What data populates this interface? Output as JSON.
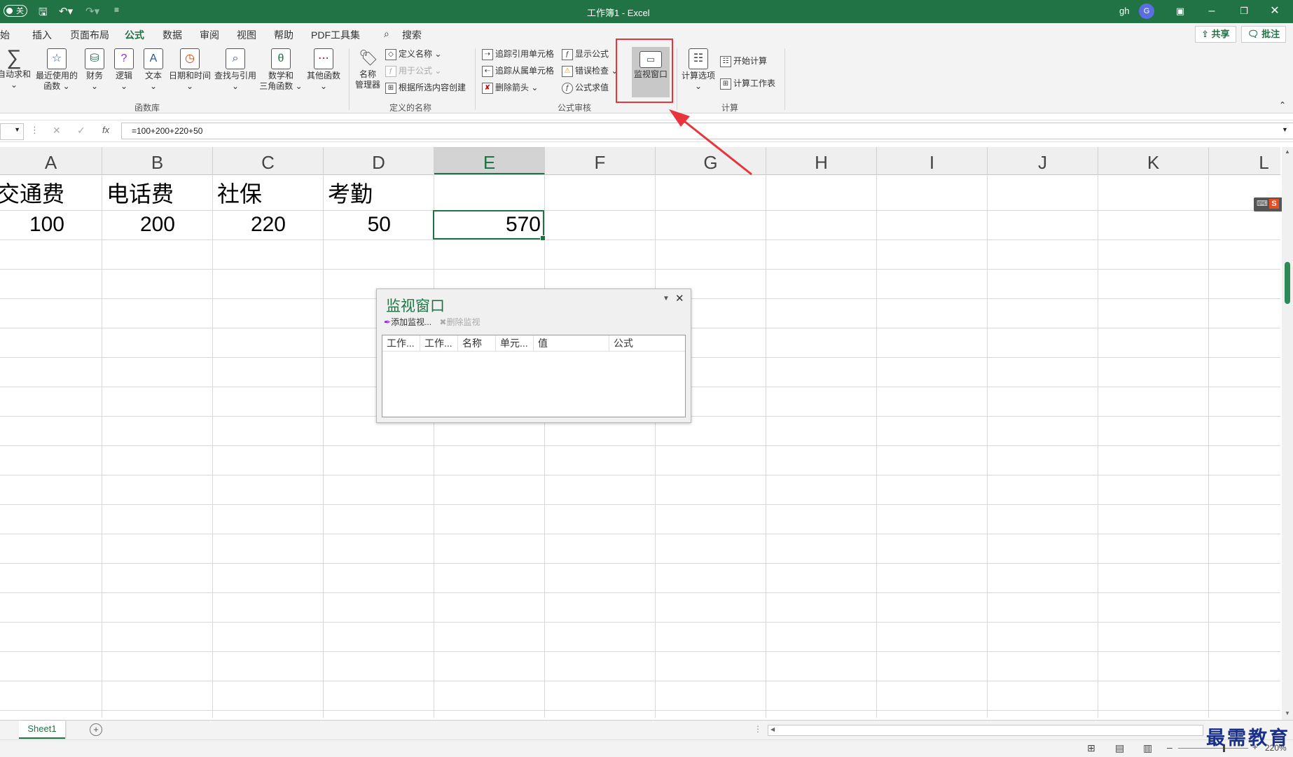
{
  "titlebar": {
    "autosave_label": "关",
    "doc_title": "工作簿1  -  Excel",
    "user_name": "gh",
    "avatar_letter": "G"
  },
  "menu": {
    "items": [
      "开始",
      "插入",
      "页面布局",
      "公式",
      "数据",
      "审阅",
      "视图",
      "帮助",
      "PDF工具集"
    ],
    "active": "公式",
    "search_label": "搜索",
    "share_label": "共享",
    "comment_label": "批注"
  },
  "ribbon": {
    "function_library": {
      "label": "函数库",
      "autosum_l1": "自动求和",
      "recent_l1": "最近使用的",
      "recent_l2": "函数",
      "finance": "财务",
      "logic": "逻辑",
      "text": "文本",
      "datetime": "日期和时间",
      "lookup": "查找与引用",
      "math_l1": "数学和",
      "math_l2": "三角函数",
      "other": "其他函数"
    },
    "defined_names": {
      "label": "定义的名称",
      "name_mgr_l1": "名称",
      "name_mgr_l2": "管理器",
      "define_name": "定义名称",
      "use_in_formula": "用于公式",
      "create_from_sel": "根据所选内容创建"
    },
    "formula_auditing": {
      "label": "公式审核",
      "trace_precedents": "追踪引用单元格",
      "trace_dependents": "追踪从属单元格",
      "remove_arrows": "删除箭头",
      "show_formulas": "显示公式",
      "error_check": "错误检查",
      "evaluate": "公式求值",
      "watch_window": "监视窗口"
    },
    "calculation": {
      "label": "计算",
      "calc_options": "计算选项",
      "calc_now": "开始计算",
      "calc_sheet": "计算工作表"
    }
  },
  "formula_bar": {
    "formula": "=100+200+220+50",
    "fx": "fx"
  },
  "grid": {
    "columns": [
      "A",
      "B",
      "C",
      "D",
      "E",
      "F",
      "G",
      "H",
      "I",
      "J",
      "K",
      "L"
    ],
    "selected_column": "E",
    "row1": [
      "交通费",
      "电话费",
      "社保",
      "考勤"
    ],
    "row2": [
      "100",
      "200",
      "220",
      "50",
      "570"
    ]
  },
  "watch_window": {
    "title": "监视窗口",
    "add_watch": "添加监视...",
    "delete_watch": "删除监视",
    "headers": [
      "工作...",
      "工作...",
      "名称",
      "单元...",
      "值",
      "公式"
    ]
  },
  "sheets": {
    "tab": "Sheet1",
    "add": "+"
  },
  "status": {
    "zoom": "220%"
  },
  "watermark": "最需教育",
  "colors": {
    "excel_green": "#217346",
    "highlight_red": "#e8343a"
  }
}
